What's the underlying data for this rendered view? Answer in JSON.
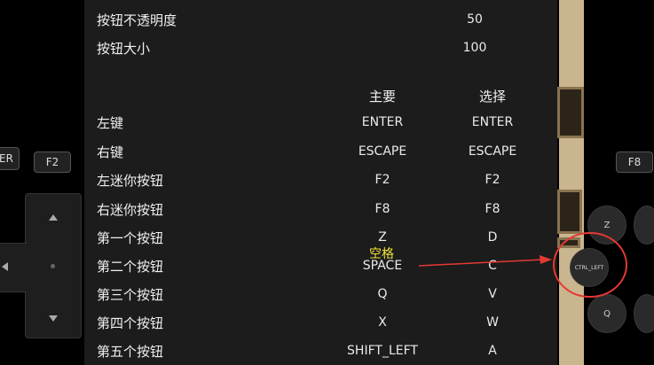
{
  "left_controls": {
    "partial_key": "ER",
    "f2_key": "F2"
  },
  "right_controls": {
    "f8_key": "F8",
    "z_button": "Z",
    "ctrl_button": "CTRL_LEFT",
    "q_button": "Q"
  },
  "settings": {
    "opacity": {
      "label": "按钮不透明度",
      "value": "50"
    },
    "size": {
      "label": "按钮大小",
      "value": "100"
    },
    "header": {
      "primary": "主要",
      "select": "选择"
    },
    "mappings": [
      {
        "label": "左键",
        "primary": "ENTER",
        "select": "ENTER"
      },
      {
        "label": "右键",
        "primary": "ESCAPE",
        "select": "ESCAPE"
      },
      {
        "label": "左迷你按钮",
        "primary": "F2",
        "select": "F2"
      },
      {
        "label": "右迷你按钮",
        "primary": "F8",
        "select": "F8"
      },
      {
        "label": "第一个按钮",
        "primary": "Z",
        "select": "D"
      },
      {
        "label": "第二个按钮",
        "primary": "SPACE",
        "select": "C"
      },
      {
        "label": "第三个按钮",
        "primary": "Q",
        "select": "V"
      },
      {
        "label": "第四个按钮",
        "primary": "X",
        "select": "W"
      },
      {
        "label": "第五个按钮",
        "primary": "SHIFT_LEFT",
        "select": "A"
      }
    ]
  },
  "annotation": {
    "text": "空格",
    "color": "#f2e23a",
    "arrow_color": "#e53935"
  }
}
